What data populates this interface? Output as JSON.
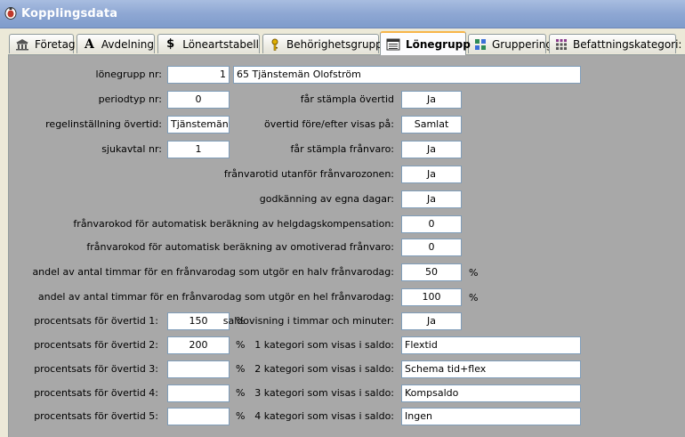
{
  "window": {
    "title": "Kopplingsdata"
  },
  "tabs": [
    {
      "label": "Företag",
      "icon": "bank-icon"
    },
    {
      "label": "Avdelning",
      "icon": "letter-a-icon"
    },
    {
      "label": "Löneartstabell",
      "icon": "dollar-icon"
    },
    {
      "label": "Behörighetsgrupp",
      "icon": "key-icon"
    },
    {
      "label": "Lönegrupp",
      "icon": "list-icon",
      "active": true
    },
    {
      "label": "Gruppering",
      "icon": "grid-icon"
    },
    {
      "label": "Befattningskategori:",
      "icon": "table-icon"
    }
  ],
  "left": {
    "lonegrupp_label": "lönegrupp nr:",
    "lonegrupp_value": "1",
    "lonegrupp_name": "65 Tjänstemän Olofström",
    "periodtyp_label": "periodtyp nr:",
    "periodtyp_value": "0",
    "regel_label": "regelinställning övertid:",
    "regel_value": "Tjänstemän",
    "sjukavtal_label": "sjukavtal nr:",
    "sjukavtal_value": "1",
    "overtid1_label": "procentsats för övertid 1:",
    "overtid1_value": "150",
    "overtid2_label": "procentsats för övertid 2:",
    "overtid2_value": "200",
    "overtid3_label": "procentsats för övertid 3:",
    "overtid3_value": "",
    "overtid4_label": "procentsats för övertid 4:",
    "overtid4_value": "",
    "overtid5_label": "procentsats för övertid 5:",
    "overtid5_value": "",
    "pct": "%"
  },
  "right": {
    "stampla_overtid_label": "får stämpla övertid",
    "stampla_overtid_value": "Ja",
    "overtid_visas_label": "övertid före/efter visas på:",
    "overtid_visas_value": "Samlat",
    "stampla_franvaro_label": "får stämpla frånvaro:",
    "stampla_franvaro_value": "Ja",
    "franvarotid_label": "frånvarotid utanför frånvarozonen:",
    "franvarotid_value": "Ja",
    "godkanning_label": "godkänning av egna dagar:",
    "godkanning_value": "Ja",
    "helgdag_label": "frånvarokod för automatisk beräkning av helgdagskompensation:",
    "helgdag_value": "0",
    "omotiverad_label": "frånvarokod för automatisk beräkning av omotiverad frånvaro:",
    "omotiverad_value": "0",
    "halv_label": "andel av antal timmar för en frånvarodag som utgör en halv frånvarodag:",
    "halv_value": "50",
    "hel_label": "andel av antal timmar för en frånvarodag som utgör en hel frånvarodag:",
    "hel_value": "100",
    "saldovisning_label": "saldovisning i timmar och minuter:",
    "saldovisning_value": "Ja",
    "kat1_label": "1 kategori som visas i saldo:",
    "kat1_value": "Flextid",
    "kat2_label": "2 kategori som visas i saldo:",
    "kat2_value": "Schema tid+flex",
    "kat3_label": "3 kategori som visas i saldo:",
    "kat3_value": "Kompsaldo",
    "kat4_label": "4 kategori som visas i saldo:",
    "kat4_value": "Ingen",
    "pct": "%"
  }
}
